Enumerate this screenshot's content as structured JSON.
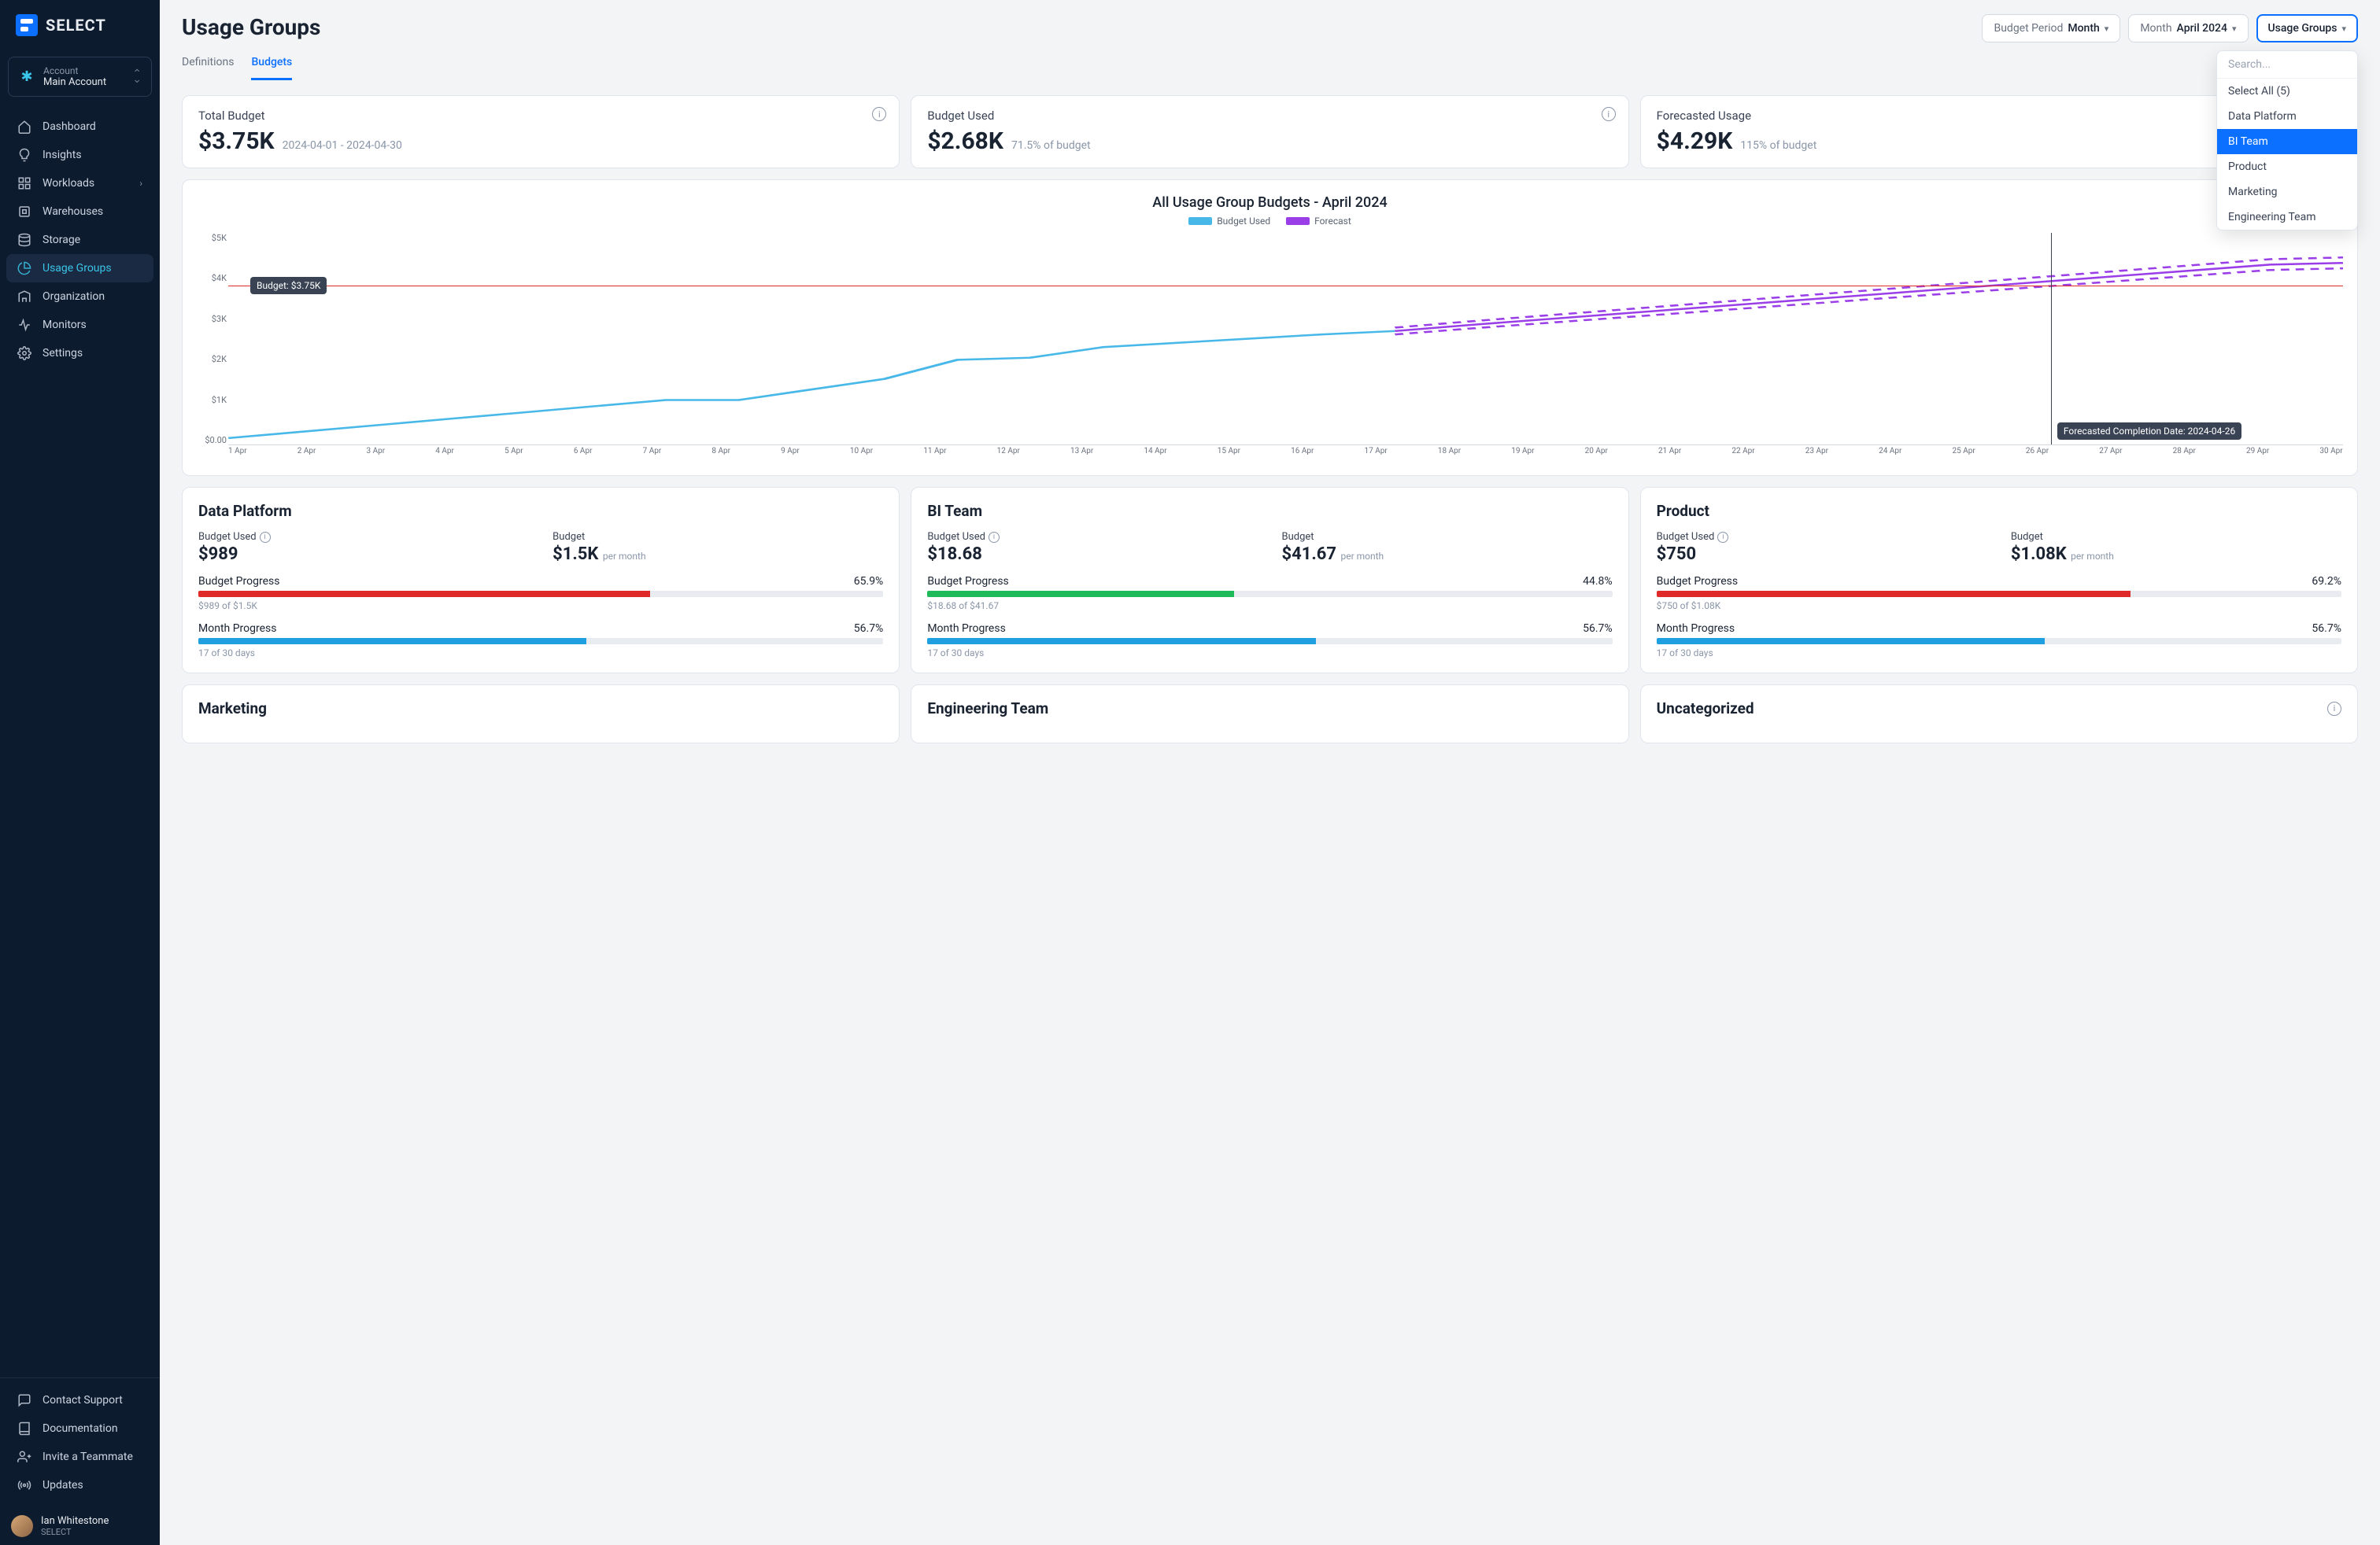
{
  "logo_text": "SELECT",
  "account": {
    "label": "Account",
    "name": "Main Account"
  },
  "nav": {
    "items": [
      {
        "label": "Dashboard",
        "icon": "home"
      },
      {
        "label": "Insights",
        "icon": "bulb"
      },
      {
        "label": "Workloads",
        "icon": "grid",
        "has_chevron": true
      },
      {
        "label": "Warehouses",
        "icon": "cpu"
      },
      {
        "label": "Storage",
        "icon": "db"
      },
      {
        "label": "Usage Groups",
        "icon": "pie",
        "active": true
      },
      {
        "label": "Organization",
        "icon": "org"
      },
      {
        "label": "Monitors",
        "icon": "pulse"
      },
      {
        "label": "Settings",
        "icon": "gear"
      }
    ],
    "bottom": [
      {
        "label": "Contact Support",
        "icon": "chat"
      },
      {
        "label": "Documentation",
        "icon": "book"
      },
      {
        "label": "Invite a Teammate",
        "icon": "user-plus"
      },
      {
        "label": "Updates",
        "icon": "broadcast"
      }
    ]
  },
  "user": {
    "name": "Ian Whitestone",
    "org": "SELECT"
  },
  "page": {
    "title": "Usage Groups"
  },
  "tabs": [
    {
      "label": "Definitions",
      "active": false
    },
    {
      "label": "Budgets",
      "active": true
    }
  ],
  "controls": {
    "budget_period": {
      "label": "Budget Period",
      "value": "Month"
    },
    "month": {
      "label": "Month",
      "value": "April 2024"
    },
    "groups": {
      "label": "Usage Groups"
    }
  },
  "dropdown": {
    "search_placeholder": "Search...",
    "select_all": "Select All (5)",
    "items": [
      "Data Platform",
      "BI Team",
      "Product",
      "Marketing",
      "Engineering Team"
    ],
    "highlighted": "BI Team"
  },
  "summary": {
    "total_budget": {
      "title": "Total Budget",
      "value": "$3.75K",
      "sub": "2024-04-01 - 2024-04-30"
    },
    "budget_used": {
      "title": "Budget Used",
      "value": "$2.68K",
      "sub": "71.5% of budget"
    },
    "forecasted": {
      "title": "Forecasted Usage",
      "value": "$4.29K",
      "sub": "115% of budget"
    }
  },
  "chart": {
    "title": "All Usage Group Budgets - April 2024",
    "legend": {
      "used": "Budget Used",
      "forecast": "Forecast"
    },
    "budget_label": "Budget: $3.75K",
    "forecast_label": "Forecasted Completion Date: 2024-04-26"
  },
  "chart_data": {
    "type": "line",
    "title": "All Usage Group Budgets - April 2024",
    "xlabel": "",
    "ylabel": "",
    "ylim": [
      0,
      5000
    ],
    "y_ticks": [
      "$5K",
      "$4K",
      "$3K",
      "$2K",
      "$1K",
      "$0.00"
    ],
    "x_ticks": [
      "1 Apr",
      "2 Apr",
      "3 Apr",
      "4 Apr",
      "5 Apr",
      "6 Apr",
      "7 Apr",
      "8 Apr",
      "9 Apr",
      "10 Apr",
      "11 Apr",
      "12 Apr",
      "13 Apr",
      "14 Apr",
      "15 Apr",
      "16 Apr",
      "17 Apr",
      "18 Apr",
      "19 Apr",
      "20 Apr",
      "21 Apr",
      "22 Apr",
      "23 Apr",
      "24 Apr",
      "25 Apr",
      "26 Apr",
      "27 Apr",
      "28 Apr",
      "29 Apr",
      "30 Apr"
    ],
    "budget_line": 3750,
    "forecast_completion_x": "26 Apr",
    "series": [
      {
        "name": "Budget Used",
        "color": "#48b8e8",
        "values": [
          150,
          300,
          450,
          600,
          750,
          900,
          1050,
          1050,
          1300,
          1550,
          2000,
          2050,
          2300,
          2400,
          2500,
          2600,
          2680
        ]
      },
      {
        "name": "Forecast",
        "color": "#9a3ee8",
        "values_from_day": 17,
        "values": [
          2680,
          2820,
          2950,
          3080,
          3210,
          3340,
          3470,
          3600,
          3730,
          3860,
          3990,
          4120,
          4250,
          4290
        ]
      }
    ]
  },
  "groups": [
    {
      "title": "Data Platform",
      "budget_used": "$989",
      "budget": "$1.5K",
      "budget_unit": "per month",
      "budget_progress_pct": "65.9%",
      "budget_progress_val": 65.9,
      "budget_color": "#e02a2a",
      "budget_sub": "$989 of $1.5K",
      "month_progress_pct": "56.7%",
      "month_progress_val": 56.7,
      "month_sub": "17 of 30 days"
    },
    {
      "title": "BI Team",
      "budget_used": "$18.68",
      "budget": "$41.67",
      "budget_unit": "per month",
      "budget_progress_pct": "44.8%",
      "budget_progress_val": 44.8,
      "budget_color": "#1fba5a",
      "budget_sub": "$18.68 of $41.67",
      "month_progress_pct": "56.7%",
      "month_progress_val": 56.7,
      "month_sub": "17 of 30 days"
    },
    {
      "title": "Product",
      "budget_used": "$750",
      "budget": "$1.08K",
      "budget_unit": "per month",
      "budget_progress_pct": "69.2%",
      "budget_progress_val": 69.2,
      "budget_color": "#e02a2a",
      "budget_sub": "$750 of $1.08K",
      "month_progress_pct": "56.7%",
      "month_progress_val": 56.7,
      "month_sub": "17 of 30 days"
    },
    {
      "title": "Marketing"
    },
    {
      "title": "Engineering Team"
    },
    {
      "title": "Uncategorized"
    }
  ],
  "labels": {
    "budget_used": "Budget Used",
    "budget": "Budget",
    "budget_progress": "Budget Progress",
    "month_progress": "Month Progress"
  }
}
